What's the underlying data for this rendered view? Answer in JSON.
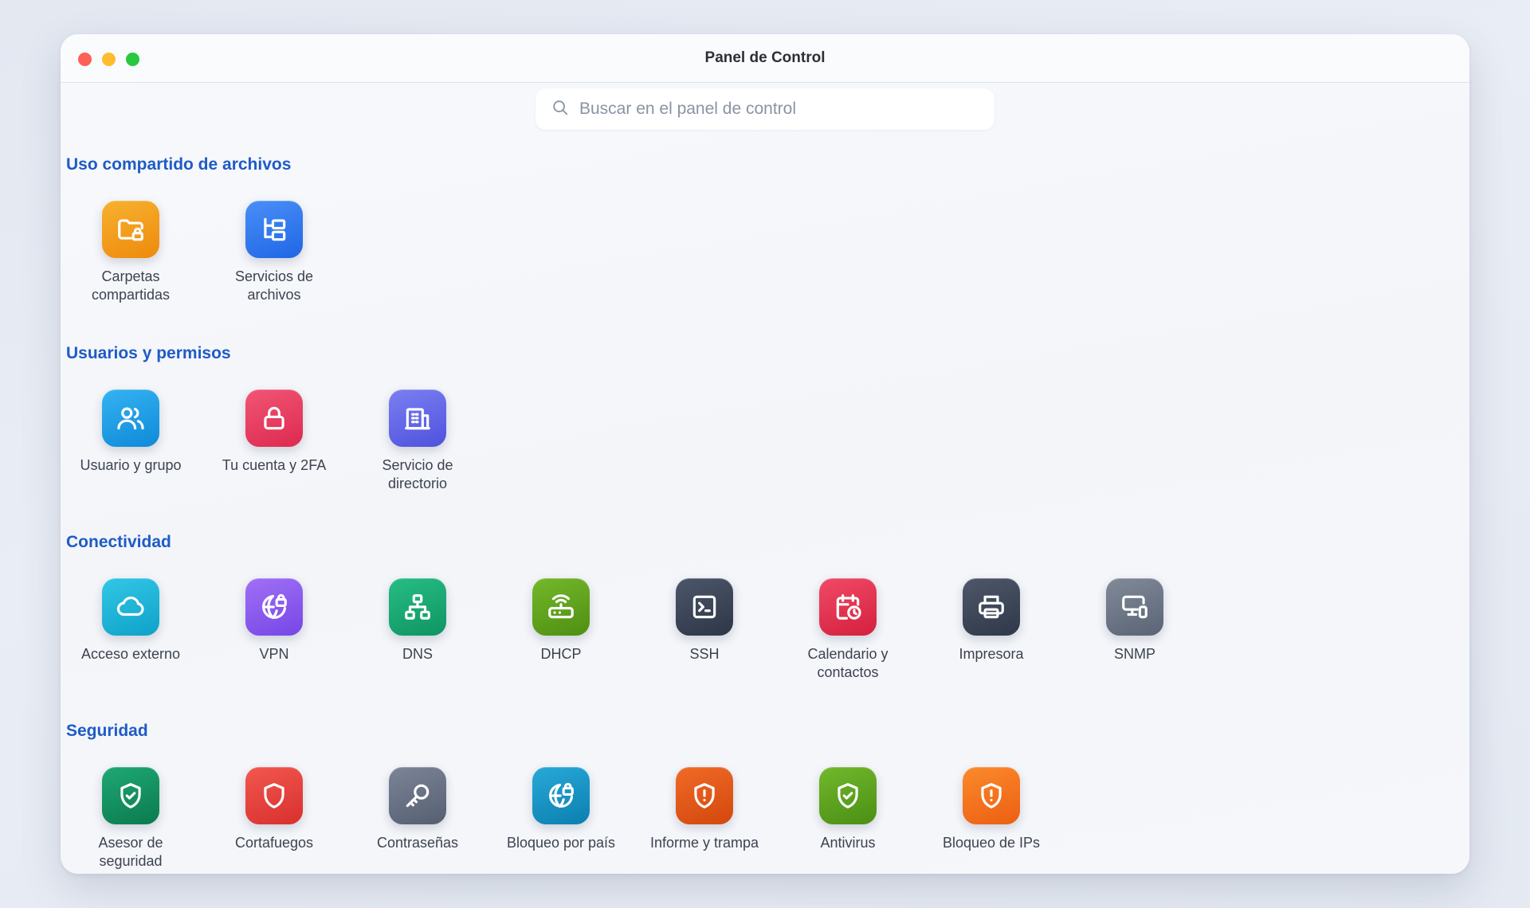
{
  "window": {
    "title": "Panel de Control"
  },
  "search": {
    "placeholder": "Buscar en el panel de control",
    "value": ""
  },
  "sections": [
    {
      "title": "Uso compartido de archivos",
      "items": [
        {
          "label": "Carpetas compartidas",
          "icon": "folder-lock-icon",
          "color": "#f39c12"
        },
        {
          "label": "Servicios de archivos",
          "icon": "folder-tree-icon",
          "color": "#2f7bf0"
        }
      ]
    },
    {
      "title": "Usuarios y permisos",
      "items": [
        {
          "label": "Usuario y grupo",
          "icon": "users-icon",
          "color": "#1fa0e8"
        },
        {
          "label": "Tu cuenta y 2FA",
          "icon": "lock-icon",
          "color": "#ec3f63"
        },
        {
          "label": "Servicio de directorio",
          "icon": "building-icon",
          "color": "#5e63e8"
        }
      ]
    },
    {
      "title": "Conectividad",
      "items": [
        {
          "label": "Acceso externo",
          "icon": "cloud-icon",
          "color": "#16b6d8"
        },
        {
          "label": "VPN",
          "icon": "globe-lock-icon",
          "color": "#8b5cf0"
        },
        {
          "label": "DNS",
          "icon": "network-icon",
          "color": "#17a673"
        },
        {
          "label": "DHCP",
          "icon": "router-icon",
          "color": "#5fa31a"
        },
        {
          "label": "SSH",
          "icon": "terminal-icon",
          "color": "#3b4658"
        },
        {
          "label": "Calendario y contactos",
          "icon": "calendar-clock-icon",
          "color": "#e53556"
        },
        {
          "label": "Impresora",
          "icon": "printer-icon",
          "color": "#3f4859"
        },
        {
          "label": "SNMP",
          "icon": "monitor-device-icon",
          "color": "#6c7787"
        }
      ]
    },
    {
      "title": "Seguridad",
      "items": [
        {
          "label": "Asesor de seguridad",
          "icon": "shield-check-icon",
          "color": "#10915f"
        },
        {
          "label": "Cortafuegos",
          "icon": "shield-icon",
          "color": "#e8423f"
        },
        {
          "label": "Contraseñas",
          "icon": "key-icon",
          "color": "#687386"
        },
        {
          "label": "Bloqueo por país",
          "icon": "globe-lock-icon",
          "color": "#1a95c8"
        },
        {
          "label": "Informe y trampa",
          "icon": "shield-alert-icon",
          "color": "#e8561a"
        },
        {
          "label": "Antivirus",
          "icon": "shield-check-icon",
          "color": "#5ca31c"
        },
        {
          "label": "Bloqueo de IPs",
          "icon": "shield-alert-icon",
          "color": "#f47318"
        }
      ]
    }
  ]
}
